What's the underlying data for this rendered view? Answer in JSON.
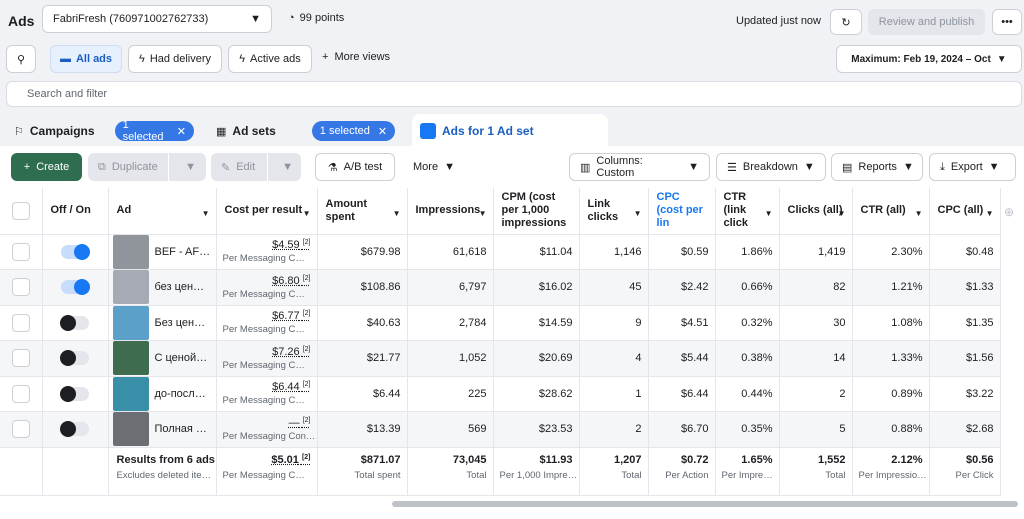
{
  "header": {
    "app_title": "Ads",
    "account": "FabriFresh (760971002762733)",
    "points": "99 points",
    "updated": "Updated just now",
    "review_label": "Review and publish"
  },
  "views": {
    "all_ads": "All ads",
    "had_delivery": "Had delivery",
    "active_ads": "Active ads",
    "more_views": "More views",
    "date_range": "Maximum: Feb 19, 2024 – Oct"
  },
  "search": {
    "placeholder": "Search and filter"
  },
  "tabs": [
    {
      "label": "Campaigns",
      "pill": "1 selected"
    },
    {
      "label": "Ad sets",
      "pill": "1 selected"
    },
    {
      "label": "Ads for 1 Ad set"
    }
  ],
  "toolbar": {
    "create": "Create",
    "duplicate": "Duplicate",
    "edit": "Edit",
    "ab_test": "A/B test",
    "more": "More",
    "columns": "Columns: Custom",
    "breakdown": "Breakdown",
    "reports": "Reports",
    "export": "Export"
  },
  "columns": [
    "Off / On",
    "Ad",
    "Cost per result",
    "Amount spent",
    "Impressions",
    "CPM (cost per 1,000 impressions",
    "Link clicks",
    "CPC (cost per lin",
    "CTR (link click",
    "Clicks (all)",
    "CTR (all)",
    "CPC (all)"
  ],
  "rows": [
    {
      "on": true,
      "ad": "BEF - AF…",
      "cpr": "$4.59",
      "cpr_sub": "Per Messaging C…",
      "spent": "$679.98",
      "impr": "61,618",
      "cpm": "$11.04",
      "link": "1,146",
      "cpc": "$0.59",
      "ctr": "1.86%",
      "clicks": "1,419",
      "ctr_all": "2.30%",
      "cpc_all": "$0.48",
      "thumb": "#8f959b"
    },
    {
      "on": true,
      "ad": "без цен…",
      "cpr": "$6.80",
      "cpr_sub": "Per Messaging C…",
      "spent": "$108.86",
      "impr": "6,797",
      "cpm": "$16.02",
      "link": "45",
      "cpc": "$2.42",
      "ctr": "0.66%",
      "clicks": "82",
      "ctr_all": "1.21%",
      "cpc_all": "$1.33",
      "thumb": "#a6aab4"
    },
    {
      "on": false,
      "ad": "Без цен…",
      "cpr": "$6.77",
      "cpr_sub": "Per Messaging C…",
      "spent": "$40.63",
      "impr": "2,784",
      "cpm": "$14.59",
      "link": "9",
      "cpc": "$4.51",
      "ctr": "0.32%",
      "clicks": "30",
      "ctr_all": "1.08%",
      "cpc_all": "$1.35",
      "thumb": "#5aa0c8"
    },
    {
      "on": false,
      "ad": "С ценой…",
      "cpr": "$7.26",
      "cpr_sub": "Per Messaging C…",
      "spent": "$21.77",
      "impr": "1,052",
      "cpm": "$20.69",
      "link": "4",
      "cpc": "$5.44",
      "ctr": "0.38%",
      "clicks": "14",
      "ctr_all": "1.33%",
      "cpc_all": "$1.56",
      "thumb": "#3f6b4e"
    },
    {
      "on": false,
      "ad": "до-посл…",
      "cpr": "$6.44",
      "cpr_sub": "Per Messaging C…",
      "spent": "$6.44",
      "impr": "225",
      "cpm": "$28.62",
      "link": "1",
      "cpc": "$6.44",
      "ctr": "0.44%",
      "clicks": "2",
      "ctr_all": "0.89%",
      "cpc_all": "$3.22",
      "thumb": "#3a8fa8"
    },
    {
      "on": false,
      "ad": "Полная …",
      "cpr": "—",
      "cpr_sub": "Per Messaging Con…",
      "spent": "$13.39",
      "impr": "569",
      "cpm": "$23.53",
      "link": "2",
      "cpc": "$6.70",
      "ctr": "0.35%",
      "clicks": "5",
      "ctr_all": "0.88%",
      "cpc_all": "$2.68",
      "thumb": "#6b6e73"
    }
  ],
  "totals": {
    "label": "Results from 6 ads",
    "label_sub": "Excludes deleted ite…",
    "cpr": "$5.01",
    "cpr_sub": "Per Messaging C…",
    "spent": "$871.07",
    "spent_sub": "Total spent",
    "impr": "73,045",
    "impr_sub": "Total",
    "cpm": "$11.93",
    "cpm_sub": "Per 1,000 Impre…",
    "link": "1,207",
    "link_sub": "Total",
    "cpc": "$0.72",
    "cpc_sub": "Per Action",
    "ctr": "1.65%",
    "ctr_sub": "Per Impre…",
    "clicks": "1,552",
    "clicks_sub": "Total",
    "ctr_all": "2.12%",
    "ctr_all_sub": "Per Impressio…",
    "cpc_all": "$0.56",
    "cpc_all_sub": "Per Click"
  },
  "sup": "[2]"
}
